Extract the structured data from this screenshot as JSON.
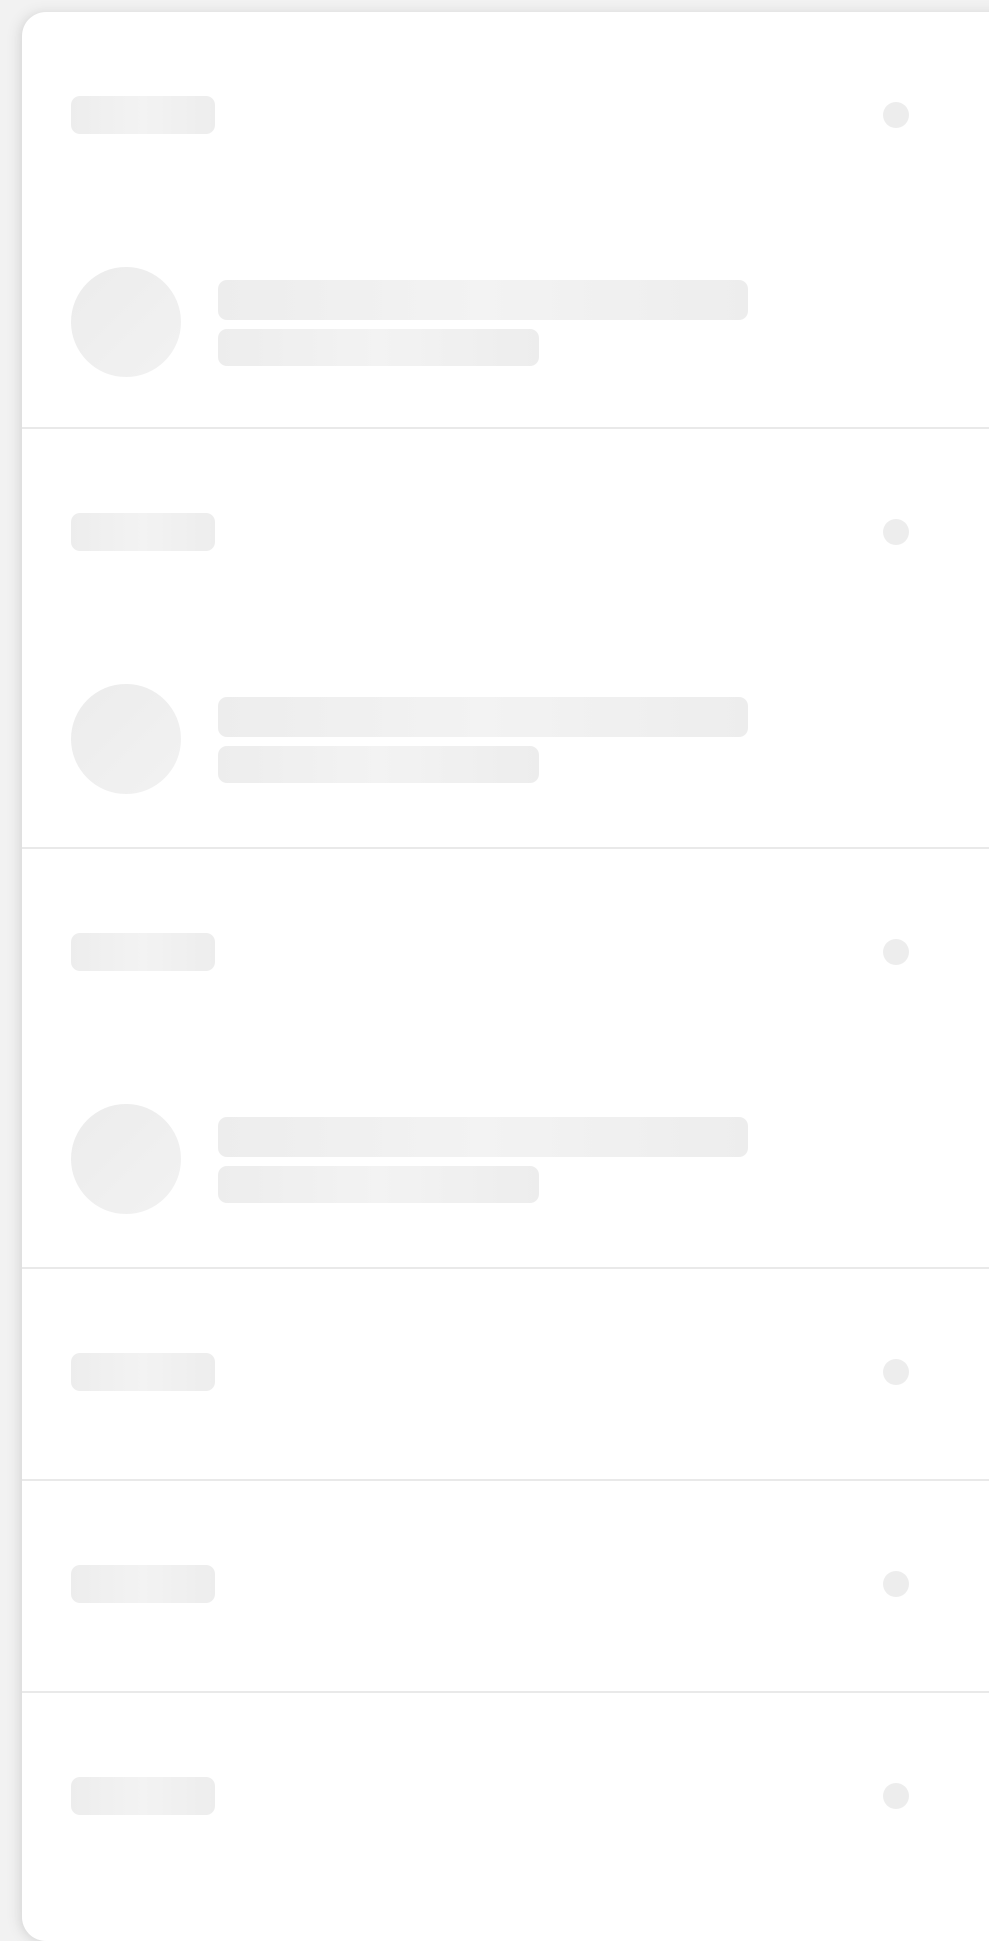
{
  "theme": {
    "background": "#f2f2f2",
    "card": "#ffffff",
    "placeholder": "#ededed",
    "divider": "#e9e9e9"
  },
  "sections": [
    {
      "kind": "header-with-profile",
      "header_placeholder": "",
      "header_dot_icon": "circle-dot-icon",
      "profile_avatar": "avatar-placeholder",
      "profile_lines": [
        "",
        ""
      ]
    },
    {
      "kind": "header-with-profile",
      "header_placeholder": "",
      "header_dot_icon": "circle-dot-icon",
      "profile_avatar": "avatar-placeholder",
      "profile_lines": [
        "",
        ""
      ]
    },
    {
      "kind": "header-with-profile",
      "header_placeholder": "",
      "header_dot_icon": "circle-dot-icon",
      "profile_avatar": "avatar-placeholder",
      "profile_lines": [
        "",
        ""
      ]
    },
    {
      "kind": "header-only",
      "header_placeholder": "",
      "header_dot_icon": "circle-dot-icon"
    },
    {
      "kind": "header-only",
      "header_placeholder": "",
      "header_dot_icon": "circle-dot-icon"
    },
    {
      "kind": "header-only",
      "header_placeholder": "",
      "header_dot_icon": "circle-dot-icon"
    }
  ]
}
